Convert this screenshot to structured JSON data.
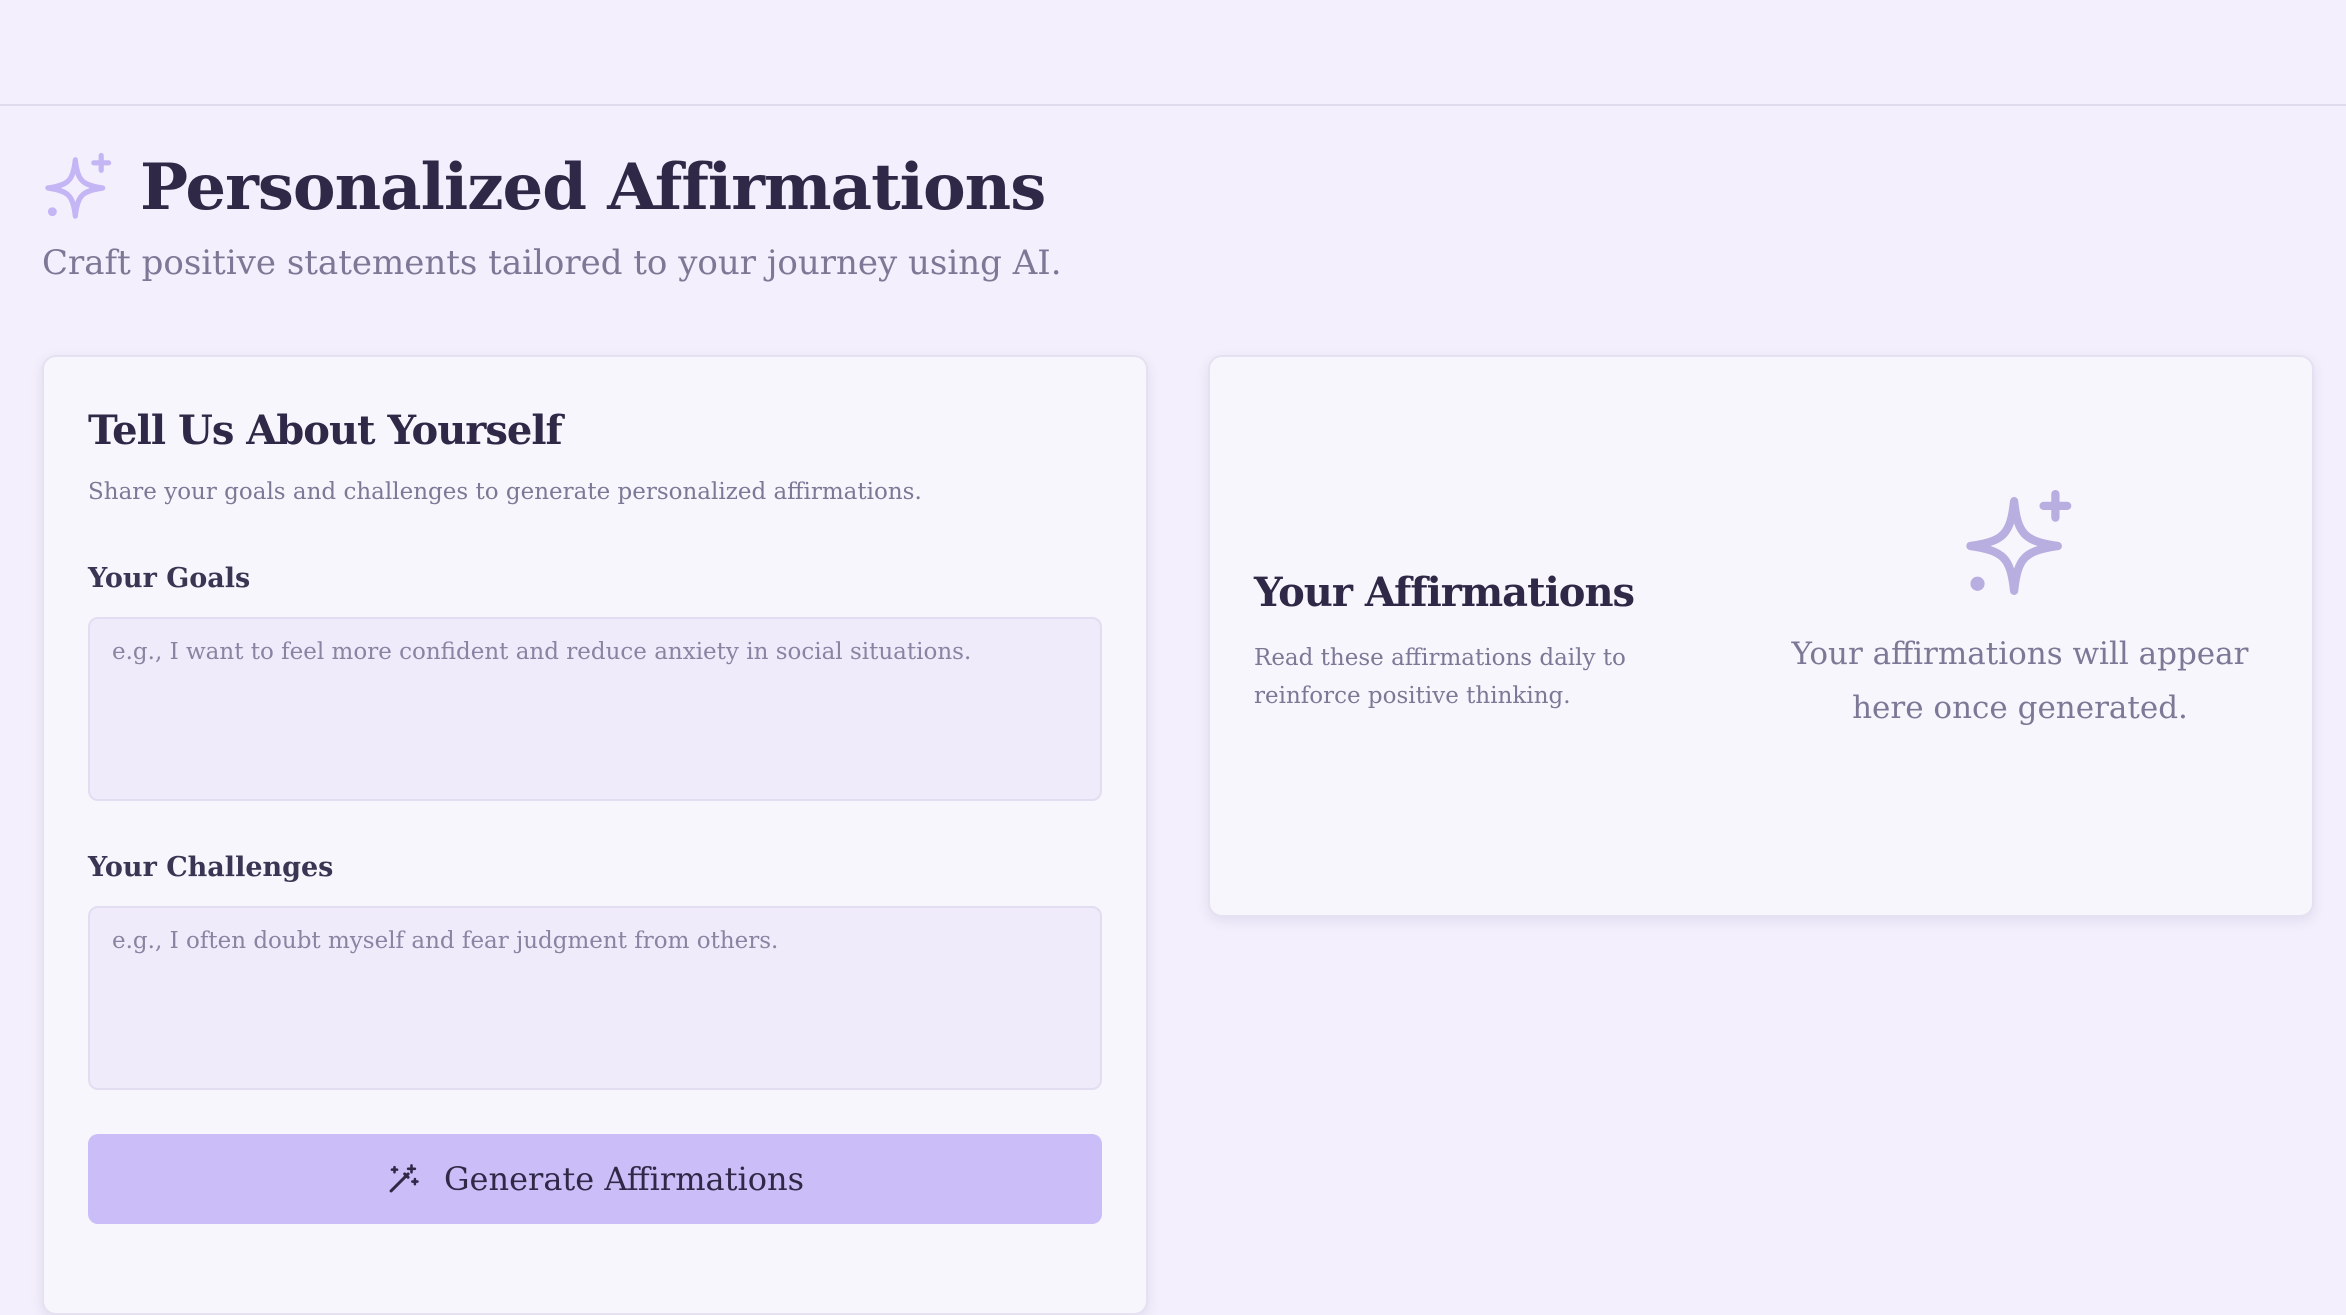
{
  "header": {
    "title": "Personalized Affirmations",
    "subtitle": "Craft positive statements tailored to your journey using AI.",
    "icon": "sparkles-icon"
  },
  "form": {
    "title": "Tell Us About Yourself",
    "description": "Share your goals and challenges to generate personalized affirmations.",
    "goals": {
      "label": "Your Goals",
      "value": "",
      "placeholder": "e.g., I want to feel more confident and reduce anxiety in social situations."
    },
    "challenges": {
      "label": "Your Challenges",
      "value": "",
      "placeholder": "e.g., I often doubt myself and fear judgment from others."
    },
    "generate_label": "Generate Affirmations",
    "generate_icon": "magic-wand-icon"
  },
  "affirmations": {
    "title": "Your Affirmations",
    "description": "Read these affirmations daily to reinforce positive thinking.",
    "empty_text": "Your affirmations will appear here once generated.",
    "empty_icon": "sparkles-icon"
  },
  "colors": {
    "background": "#f3effc",
    "accent": "#cbbdf7",
    "icon": "#c4b5f5",
    "icon_muted": "#b8aee0",
    "text": "#2f2947",
    "muted_text": "#7d7896"
  }
}
